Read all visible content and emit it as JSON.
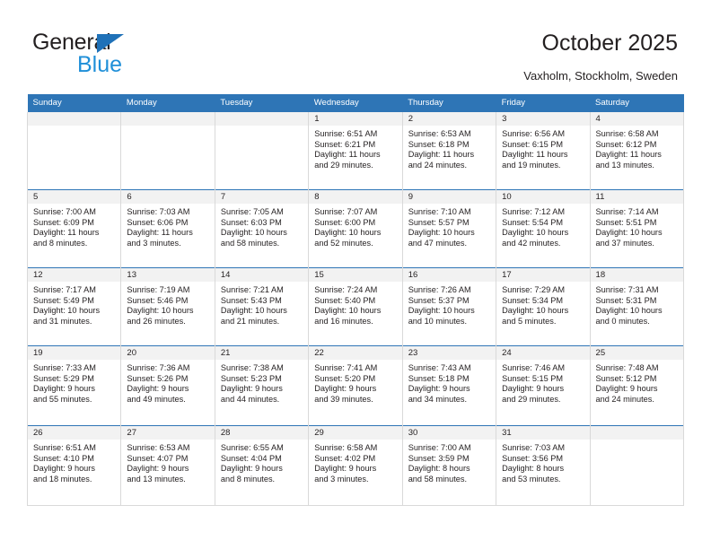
{
  "brand": {
    "name_part1": "General",
    "name_part2": "Blue",
    "triangle_color": "#1f71b8",
    "blue_color": "#1f8fd8"
  },
  "header": {
    "title": "October 2025",
    "subtitle": "Vaxholm, Stockholm, Sweden"
  },
  "theme": {
    "header_band": "#2e75b6",
    "daynum_band": "#f2f2f2",
    "row_divider": "#2e75b6",
    "cell_border": "#d9d9d9"
  },
  "weekdays": [
    "Sunday",
    "Monday",
    "Tuesday",
    "Wednesday",
    "Thursday",
    "Friday",
    "Saturday"
  ],
  "weeks": [
    [
      {
        "day": "",
        "sunrise": "",
        "sunset": "",
        "daylight1": "",
        "daylight2": ""
      },
      {
        "day": "",
        "sunrise": "",
        "sunset": "",
        "daylight1": "",
        "daylight2": ""
      },
      {
        "day": "",
        "sunrise": "",
        "sunset": "",
        "daylight1": "",
        "daylight2": ""
      },
      {
        "day": "1",
        "sunrise": "Sunrise: 6:51 AM",
        "sunset": "Sunset: 6:21 PM",
        "daylight1": "Daylight: 11 hours",
        "daylight2": "and 29 minutes."
      },
      {
        "day": "2",
        "sunrise": "Sunrise: 6:53 AM",
        "sunset": "Sunset: 6:18 PM",
        "daylight1": "Daylight: 11 hours",
        "daylight2": "and 24 minutes."
      },
      {
        "day": "3",
        "sunrise": "Sunrise: 6:56 AM",
        "sunset": "Sunset: 6:15 PM",
        "daylight1": "Daylight: 11 hours",
        "daylight2": "and 19 minutes."
      },
      {
        "day": "4",
        "sunrise": "Sunrise: 6:58 AM",
        "sunset": "Sunset: 6:12 PM",
        "daylight1": "Daylight: 11 hours",
        "daylight2": "and 13 minutes."
      }
    ],
    [
      {
        "day": "5",
        "sunrise": "Sunrise: 7:00 AM",
        "sunset": "Sunset: 6:09 PM",
        "daylight1": "Daylight: 11 hours",
        "daylight2": "and 8 minutes."
      },
      {
        "day": "6",
        "sunrise": "Sunrise: 7:03 AM",
        "sunset": "Sunset: 6:06 PM",
        "daylight1": "Daylight: 11 hours",
        "daylight2": "and 3 minutes."
      },
      {
        "day": "7",
        "sunrise": "Sunrise: 7:05 AM",
        "sunset": "Sunset: 6:03 PM",
        "daylight1": "Daylight: 10 hours",
        "daylight2": "and 58 minutes."
      },
      {
        "day": "8",
        "sunrise": "Sunrise: 7:07 AM",
        "sunset": "Sunset: 6:00 PM",
        "daylight1": "Daylight: 10 hours",
        "daylight2": "and 52 minutes."
      },
      {
        "day": "9",
        "sunrise": "Sunrise: 7:10 AM",
        "sunset": "Sunset: 5:57 PM",
        "daylight1": "Daylight: 10 hours",
        "daylight2": "and 47 minutes."
      },
      {
        "day": "10",
        "sunrise": "Sunrise: 7:12 AM",
        "sunset": "Sunset: 5:54 PM",
        "daylight1": "Daylight: 10 hours",
        "daylight2": "and 42 minutes."
      },
      {
        "day": "11",
        "sunrise": "Sunrise: 7:14 AM",
        "sunset": "Sunset: 5:51 PM",
        "daylight1": "Daylight: 10 hours",
        "daylight2": "and 37 minutes."
      }
    ],
    [
      {
        "day": "12",
        "sunrise": "Sunrise: 7:17 AM",
        "sunset": "Sunset: 5:49 PM",
        "daylight1": "Daylight: 10 hours",
        "daylight2": "and 31 minutes."
      },
      {
        "day": "13",
        "sunrise": "Sunrise: 7:19 AM",
        "sunset": "Sunset: 5:46 PM",
        "daylight1": "Daylight: 10 hours",
        "daylight2": "and 26 minutes."
      },
      {
        "day": "14",
        "sunrise": "Sunrise: 7:21 AM",
        "sunset": "Sunset: 5:43 PM",
        "daylight1": "Daylight: 10 hours",
        "daylight2": "and 21 minutes."
      },
      {
        "day": "15",
        "sunrise": "Sunrise: 7:24 AM",
        "sunset": "Sunset: 5:40 PM",
        "daylight1": "Daylight: 10 hours",
        "daylight2": "and 16 minutes."
      },
      {
        "day": "16",
        "sunrise": "Sunrise: 7:26 AM",
        "sunset": "Sunset: 5:37 PM",
        "daylight1": "Daylight: 10 hours",
        "daylight2": "and 10 minutes."
      },
      {
        "day": "17",
        "sunrise": "Sunrise: 7:29 AM",
        "sunset": "Sunset: 5:34 PM",
        "daylight1": "Daylight: 10 hours",
        "daylight2": "and 5 minutes."
      },
      {
        "day": "18",
        "sunrise": "Sunrise: 7:31 AM",
        "sunset": "Sunset: 5:31 PM",
        "daylight1": "Daylight: 10 hours",
        "daylight2": "and 0 minutes."
      }
    ],
    [
      {
        "day": "19",
        "sunrise": "Sunrise: 7:33 AM",
        "sunset": "Sunset: 5:29 PM",
        "daylight1": "Daylight: 9 hours",
        "daylight2": "and 55 minutes."
      },
      {
        "day": "20",
        "sunrise": "Sunrise: 7:36 AM",
        "sunset": "Sunset: 5:26 PM",
        "daylight1": "Daylight: 9 hours",
        "daylight2": "and 49 minutes."
      },
      {
        "day": "21",
        "sunrise": "Sunrise: 7:38 AM",
        "sunset": "Sunset: 5:23 PM",
        "daylight1": "Daylight: 9 hours",
        "daylight2": "and 44 minutes."
      },
      {
        "day": "22",
        "sunrise": "Sunrise: 7:41 AM",
        "sunset": "Sunset: 5:20 PM",
        "daylight1": "Daylight: 9 hours",
        "daylight2": "and 39 minutes."
      },
      {
        "day": "23",
        "sunrise": "Sunrise: 7:43 AM",
        "sunset": "Sunset: 5:18 PM",
        "daylight1": "Daylight: 9 hours",
        "daylight2": "and 34 minutes."
      },
      {
        "day": "24",
        "sunrise": "Sunrise: 7:46 AM",
        "sunset": "Sunset: 5:15 PM",
        "daylight1": "Daylight: 9 hours",
        "daylight2": "and 29 minutes."
      },
      {
        "day": "25",
        "sunrise": "Sunrise: 7:48 AM",
        "sunset": "Sunset: 5:12 PM",
        "daylight1": "Daylight: 9 hours",
        "daylight2": "and 24 minutes."
      }
    ],
    [
      {
        "day": "26",
        "sunrise": "Sunrise: 6:51 AM",
        "sunset": "Sunset: 4:10 PM",
        "daylight1": "Daylight: 9 hours",
        "daylight2": "and 18 minutes."
      },
      {
        "day": "27",
        "sunrise": "Sunrise: 6:53 AM",
        "sunset": "Sunset: 4:07 PM",
        "daylight1": "Daylight: 9 hours",
        "daylight2": "and 13 minutes."
      },
      {
        "day": "28",
        "sunrise": "Sunrise: 6:55 AM",
        "sunset": "Sunset: 4:04 PM",
        "daylight1": "Daylight: 9 hours",
        "daylight2": "and 8 minutes."
      },
      {
        "day": "29",
        "sunrise": "Sunrise: 6:58 AM",
        "sunset": "Sunset: 4:02 PM",
        "daylight1": "Daylight: 9 hours",
        "daylight2": "and 3 minutes."
      },
      {
        "day": "30",
        "sunrise": "Sunrise: 7:00 AM",
        "sunset": "Sunset: 3:59 PM",
        "daylight1": "Daylight: 8 hours",
        "daylight2": "and 58 minutes."
      },
      {
        "day": "31",
        "sunrise": "Sunrise: 7:03 AM",
        "sunset": "Sunset: 3:56 PM",
        "daylight1": "Daylight: 8 hours",
        "daylight2": "and 53 minutes."
      },
      {
        "day": "",
        "sunrise": "",
        "sunset": "",
        "daylight1": "",
        "daylight2": ""
      }
    ]
  ]
}
